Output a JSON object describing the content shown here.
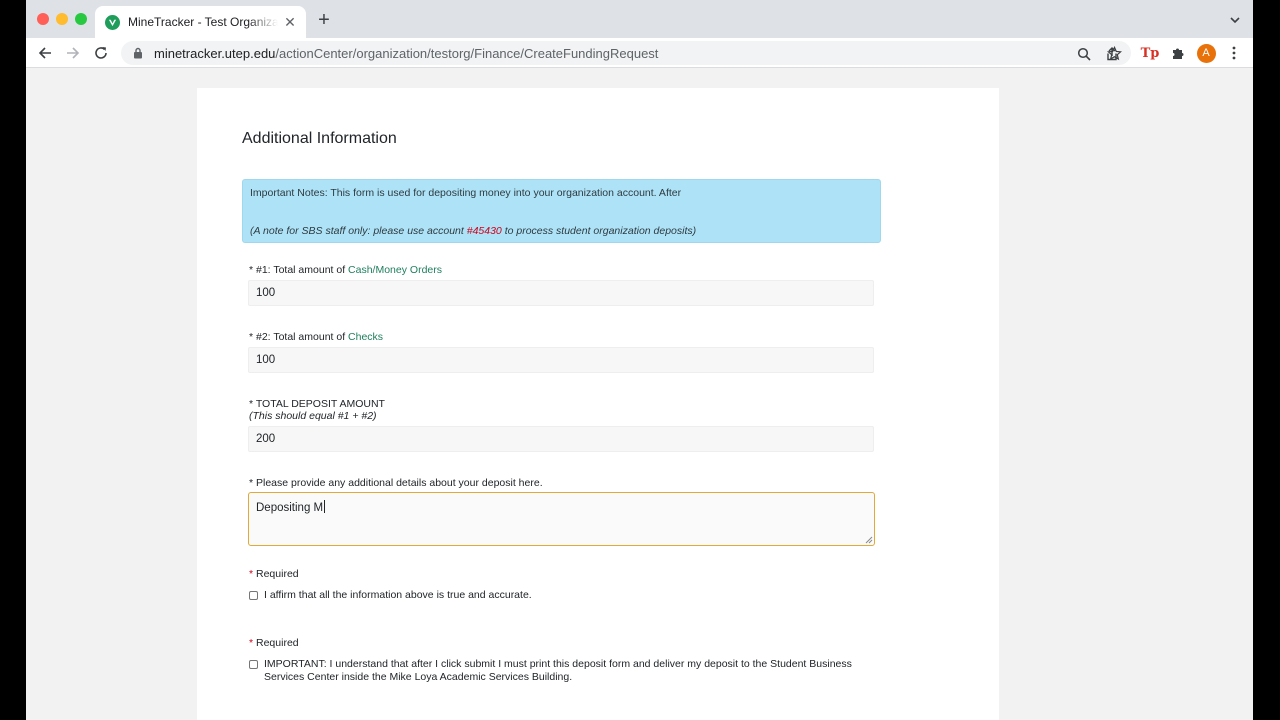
{
  "browser": {
    "tab_title": "MineTracker - Test Organization",
    "new_tab_symbol": "+",
    "close_symbol": "✕",
    "url_host": "minetracker.utep.edu",
    "url_path": "/actionCenter/organization/testorg/Finance/CreateFundingRequest",
    "profile_initial": "A",
    "extension_label": "Tp",
    "accent_color": "#e8710a"
  },
  "form": {
    "section_title": "Additional Information",
    "notice": {
      "line1": "Important Notes: This form is used for depositing money into your organization account. After",
      "line2_prefix": "(A note for SBS staff only: please use account ",
      "account": "#45430",
      "line2_suffix": " to process student organization deposits)"
    },
    "cash": {
      "label_prefix": "* #1: Total amount of ",
      "label_link": "Cash/Money Orders",
      "value": "100"
    },
    "checks": {
      "label_prefix": "* #2: Total amount of ",
      "label_link": "Checks",
      "value": "100"
    },
    "total": {
      "label": "* TOTAL DEPOSIT AMOUNT",
      "hint": "(This should equal #1 + #2)",
      "value": "200"
    },
    "details": {
      "label": "* Please provide any additional details about your deposit here.",
      "value": "Depositing M"
    },
    "affirm": {
      "required_star": "*",
      "required_text": " Required",
      "checkbox_label": "I affirm that all the information above is true and accurate.",
      "checked": false
    },
    "important": {
      "required_star": "*",
      "required_text": " Required",
      "checkbox_label": "IMPORTANT: I understand that after I click submit I must print this deposit form and deliver my deposit to the Student Business Services Center inside the Mike Loya Academic Services Building.",
      "checked": false
    }
  }
}
